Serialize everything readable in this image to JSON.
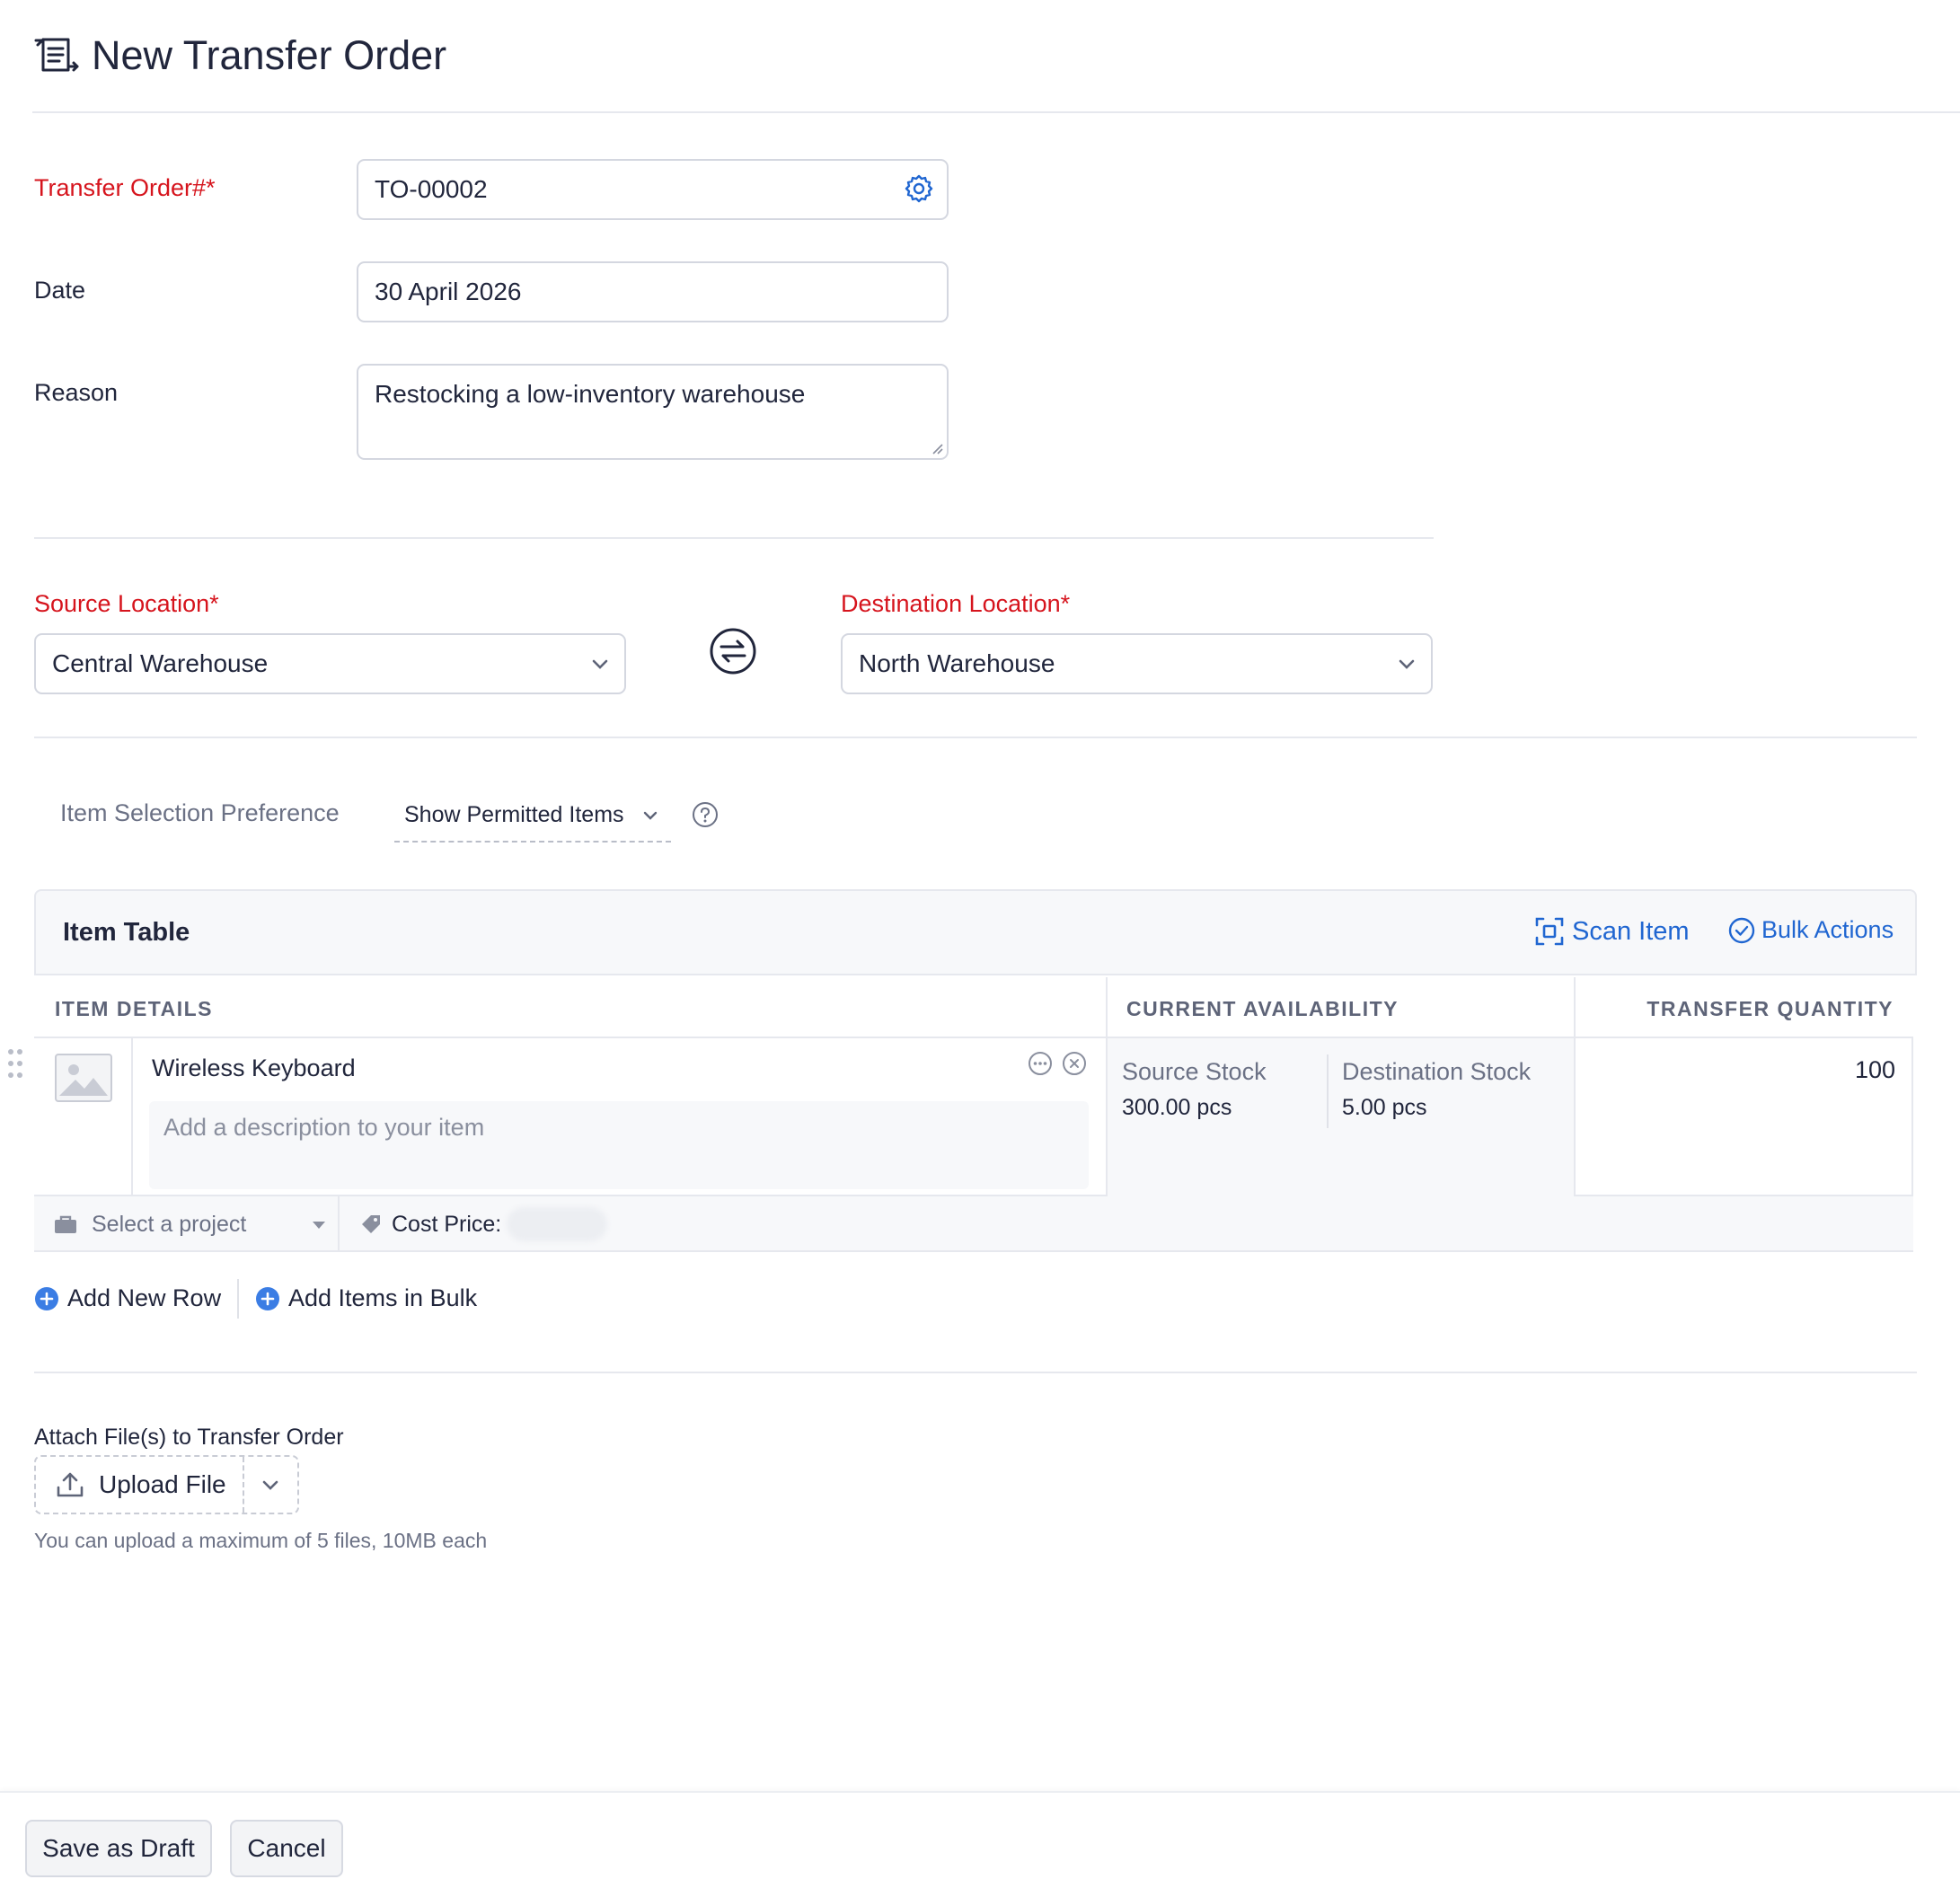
{
  "header": {
    "title": "New Transfer Order",
    "title_icon": "transfer-order-icon"
  },
  "form": {
    "transfer_order_label": "Transfer Order#*",
    "transfer_order_value": "TO-00002",
    "date_label": "Date",
    "date_value": "30 April 2026",
    "reason_label": "Reason",
    "reason_value": "Restocking a low-inventory warehouse"
  },
  "locations": {
    "source_label": "Source Location*",
    "source_value": "Central Warehouse",
    "destination_label": "Destination Location*",
    "destination_value": "North Warehouse"
  },
  "preference": {
    "label": "Item Selection Preference",
    "value": "Show Permitted Items"
  },
  "item_table": {
    "title": "Item Table",
    "scan_item": "Scan Item",
    "bulk_actions": "Bulk Actions",
    "columns": {
      "item_details": "ITEM DETAILS",
      "current_availability": "CURRENT AVAILABILITY",
      "transfer_quantity": "TRANSFER QUANTITY"
    },
    "rows": [
      {
        "name": "Wireless Keyboard",
        "description_placeholder": "Add a description to your item",
        "source_stock_label": "Source Stock",
        "source_stock_value": "300.00 pcs",
        "destination_stock_label": "Destination Stock",
        "destination_stock_value": "5.00 pcs",
        "quantity": "100",
        "project_placeholder": "Select a project",
        "cost_price_label": "Cost Price:"
      }
    ],
    "add_new_row": "Add New Row",
    "add_items_bulk": "Add Items in Bulk"
  },
  "attachments": {
    "label": "Attach File(s) to Transfer Order",
    "upload_button": "Upload File",
    "hint": "You can upload a maximum of 5 files, 10MB each"
  },
  "footer": {
    "save_draft": "Save as Draft",
    "cancel": "Cancel"
  },
  "colors": {
    "required": "#d6141d",
    "link": "#2066d1",
    "text": "#21263c",
    "muted": "#6b7185"
  }
}
